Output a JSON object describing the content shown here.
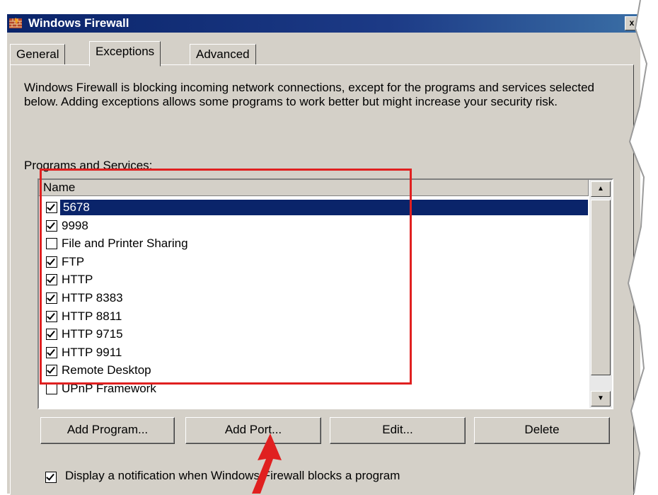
{
  "window": {
    "title": "Windows Firewall",
    "close_glyph": "x"
  },
  "tabs": [
    {
      "label": "General",
      "active": false
    },
    {
      "label": "Exceptions",
      "active": true
    },
    {
      "label": "Advanced",
      "active": false
    }
  ],
  "description": "Windows Firewall is blocking incoming network connections, except for the programs and services selected below. Adding exceptions allows some programs to work better but might increase your security risk.",
  "programs_label": "Programs and Services:",
  "list": {
    "column_header": "Name",
    "items": [
      {
        "label": "5678",
        "checked": true,
        "selected": true
      },
      {
        "label": "9998",
        "checked": true,
        "selected": false
      },
      {
        "label": "File and Printer Sharing",
        "checked": false,
        "selected": false
      },
      {
        "label": "FTP",
        "checked": true,
        "selected": false
      },
      {
        "label": "HTTP",
        "checked": true,
        "selected": false
      },
      {
        "label": "HTTP 8383",
        "checked": true,
        "selected": false
      },
      {
        "label": "HTTP 8811",
        "checked": true,
        "selected": false
      },
      {
        "label": "HTTP 9715",
        "checked": true,
        "selected": false
      },
      {
        "label": "HTTP 9911",
        "checked": true,
        "selected": false
      },
      {
        "label": "Remote Desktop",
        "checked": true,
        "selected": false
      },
      {
        "label": "UPnP Framework",
        "checked": false,
        "selected": false
      }
    ]
  },
  "buttons": {
    "add_program": "Add Program...",
    "add_port": "Add Port...",
    "edit": "Edit...",
    "delete": "Delete"
  },
  "notification": {
    "label": "Display a notification when Windows Firewall blocks a program",
    "checked": true
  },
  "colors": {
    "highlight_box": "#e02020",
    "arrow": "#e02020",
    "selection": "#0a246a",
    "dialog_face": "#d4d0c8"
  }
}
